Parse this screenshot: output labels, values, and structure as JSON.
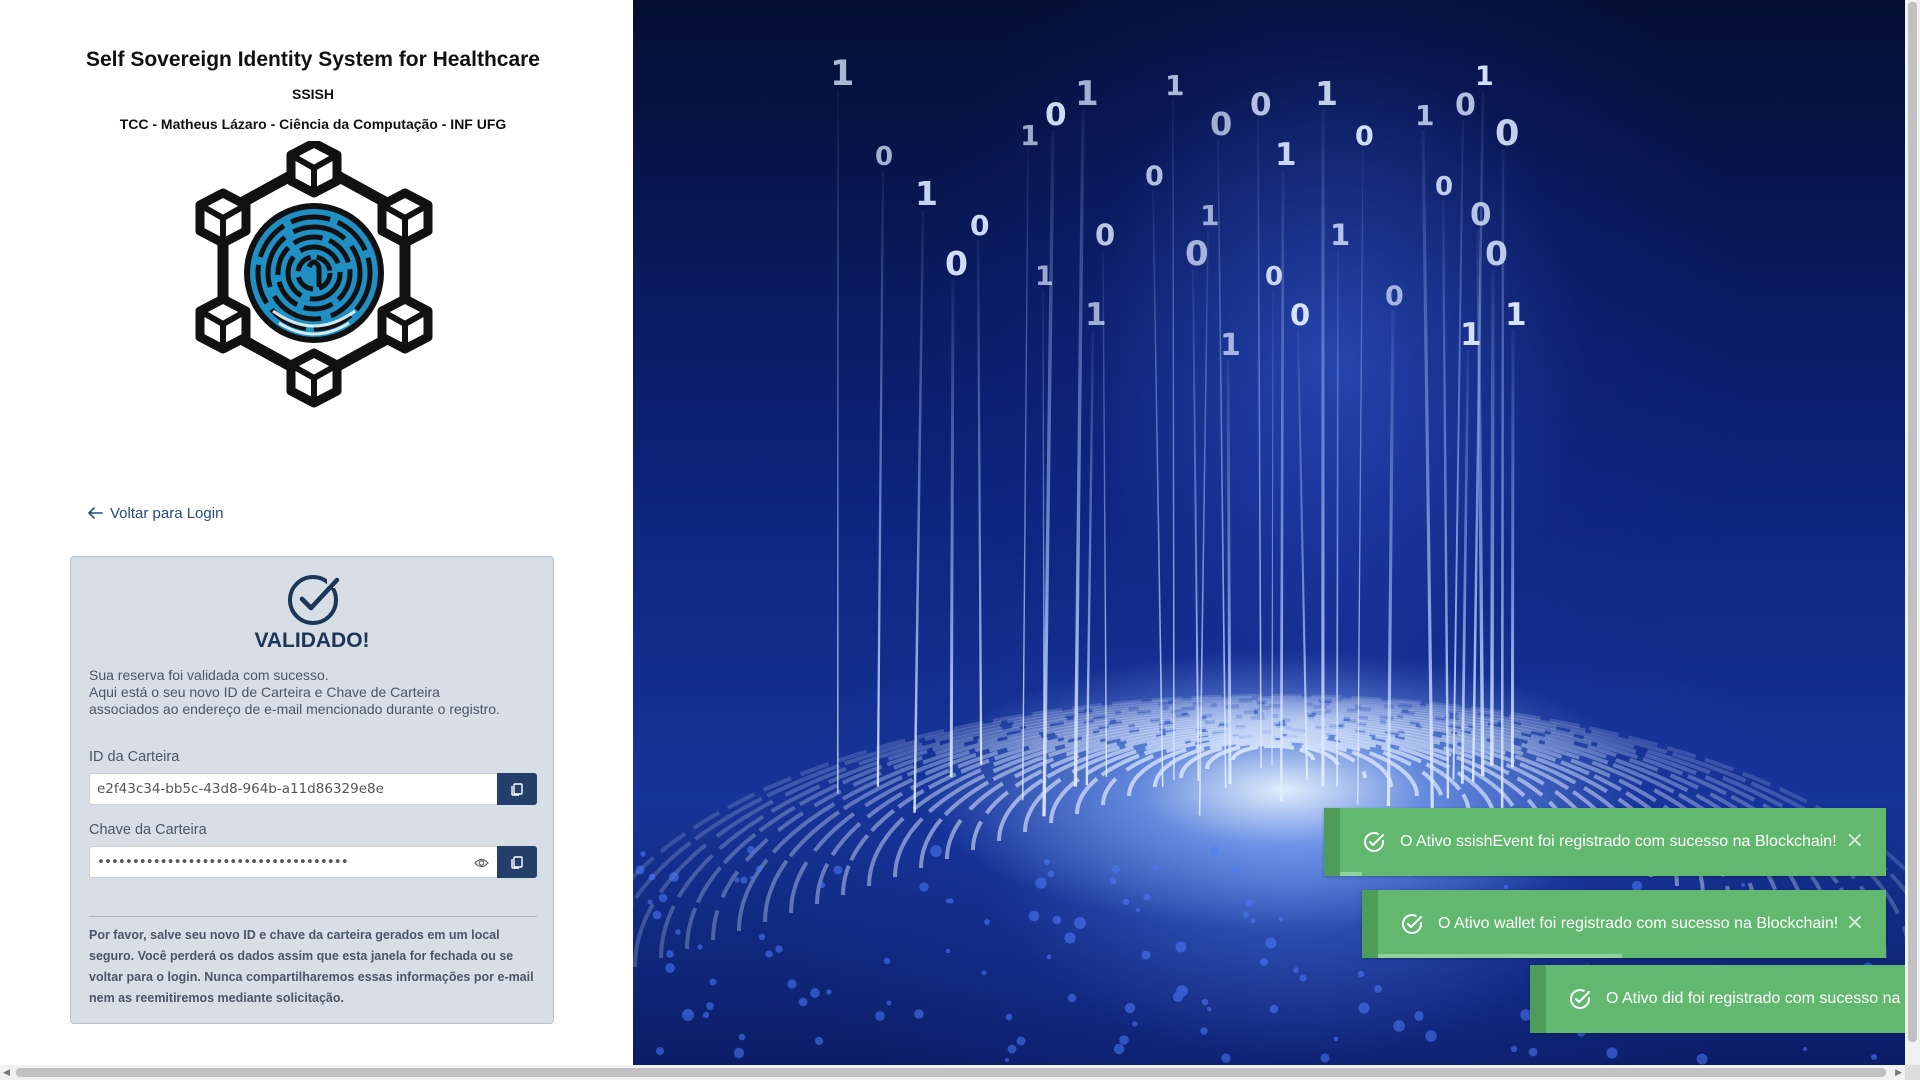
{
  "header": {
    "title": "Self Sovereign Identity System for Healthcare",
    "acronym": "SSISH",
    "credits": "TCC - Matheus Lázaro - Ciência da Computação - INF UFG"
  },
  "back_link": {
    "label": "Voltar para Login",
    "icon": "arrow-left-icon"
  },
  "card": {
    "status_icon": "check-circle-icon",
    "status_title": "VALIDADO!",
    "message_lines": [
      "Sua reserva foi validada com sucesso.",
      "Aqui está o seu novo ID de Carteira e Chave de Carteira",
      "associados ao endereço de e-mail mencionado durante o registro."
    ],
    "wallet_id": {
      "label": "ID da Carteira",
      "value": "e2f43c34-bb5c-43d8-964b-a11d86329e8e"
    },
    "wallet_key": {
      "label": "Chave da Carteira",
      "masked_value": "••••••••••••••••••••••••••••••••••••"
    },
    "warning": "Por favor, salve seu novo ID e chave da carteira gerados em um local seguro. Você perderá os dados assim que esta janela for fechada ou se voltar para o login. Nunca compartilharemos essas informações por e-mail nem as reemitiremos mediante solicitação."
  },
  "toasts": [
    {
      "text": "O Ativo ssishEvent foi registrado com sucesso na Blockchain!",
      "close": "×",
      "progress": 0.04
    },
    {
      "text": "O Ativo wallet foi registrado com sucesso na Blockchain!",
      "close": "×",
      "progress": 0.48
    },
    {
      "text": "O Ativo did foi registrado com sucesso na Blockchain!",
      "close": "×",
      "progress": 0.0
    }
  ],
  "colors": {
    "navy": "#24406a",
    "card_bg": "#d8dee6",
    "toast_green": "#62b86e",
    "toast_green_dark": "#4d9c58"
  },
  "background_digits": [
    "1",
    "0",
    "1",
    "0",
    "0",
    "1",
    "1",
    "0",
    "1",
    "1",
    "0",
    "0",
    "1",
    "0",
    "1",
    "0",
    "1",
    "0",
    "0",
    "1",
    "0",
    "1",
    "1",
    "0",
    "0",
    "1",
    "0",
    "0",
    "1",
    "0",
    "1",
    "0",
    "0",
    "1"
  ]
}
